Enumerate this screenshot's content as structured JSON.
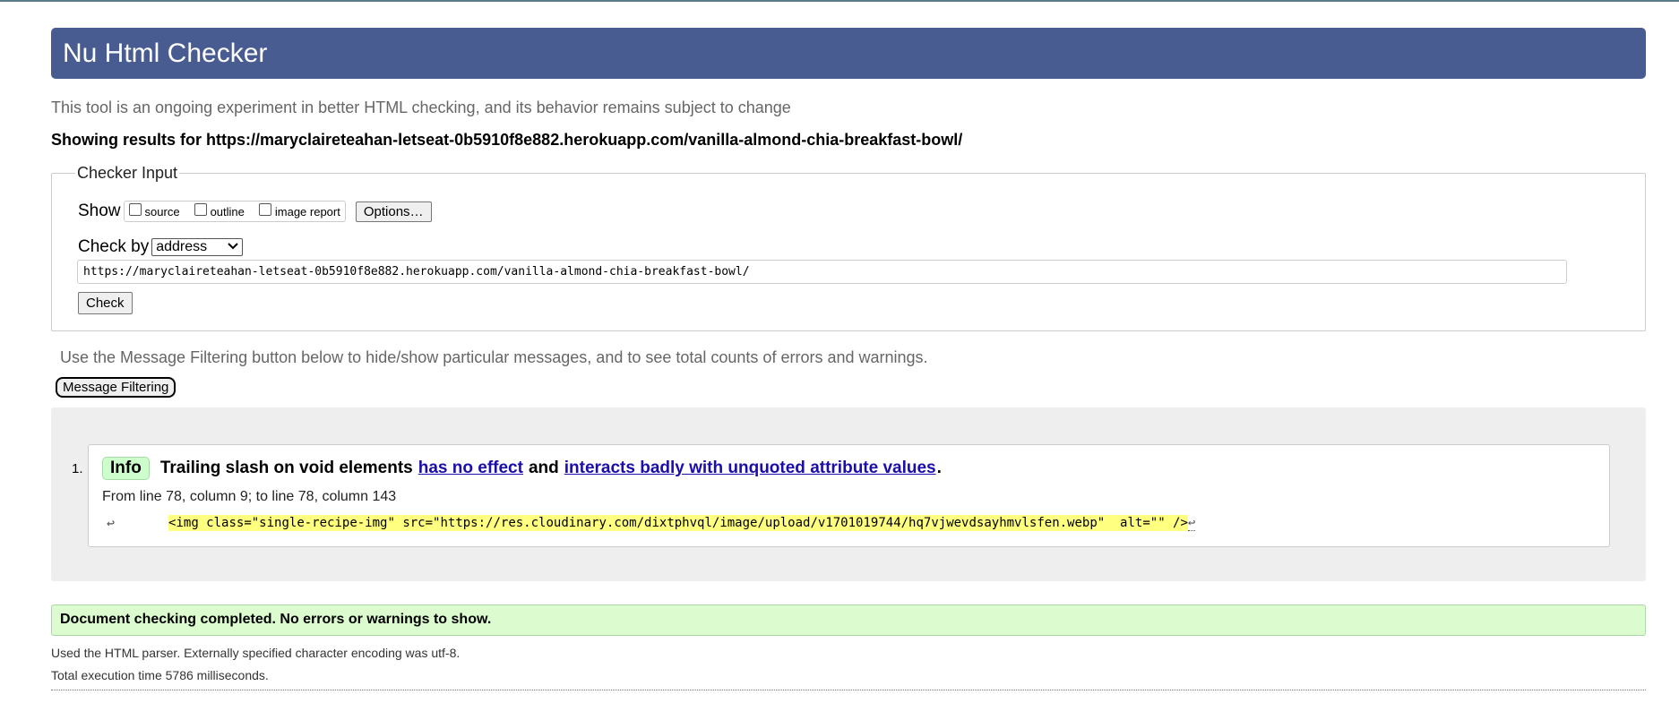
{
  "header": {
    "title": "Nu Html Checker"
  },
  "subtitle": "This tool is an ongoing experiment in better HTML checking, and its behavior remains subject to change",
  "showing_results": "Showing results for https://maryclaireteahan-letseat-0b5910f8e882.herokuapp.com/vanilla-almond-chia-breakfast-bowl/",
  "checker_input": {
    "legend": "Checker Input",
    "show_label": "Show",
    "show_options": [
      "source",
      "outline",
      "image report"
    ],
    "options_button": "Options…",
    "check_by_label": "Check by",
    "check_by_value": "address",
    "url_value": "https://maryclaireteahan-letseat-0b5910f8e882.herokuapp.com/vanilla-almond-chia-breakfast-bowl/",
    "check_button": "Check"
  },
  "filtering": {
    "note": "Use the Message Filtering button below to hide/show particular messages, and to see total counts of errors and warnings.",
    "button": "Message Filtering"
  },
  "messages": [
    {
      "number": "1.",
      "type": "Info",
      "text_before": "Trailing slash on void elements",
      "link1": "has no effect",
      "text_middle": "and",
      "link2": "interacts badly with unquoted attribute values",
      "text_end": ".",
      "location": "From line 78, column 9; to line 78, column 143",
      "return_symbol": "↩",
      "extract": "<img class=\"single-recipe-img\" src=\"https://res.cloudinary.com/dixtphvql/image/upload/v1701019744/hq7vjwevdsayhmvlsfen.webp\"  alt=\"\" />"
    }
  ],
  "status": {
    "completed": "Document checking completed. No errors or warnings to show.",
    "parser": "Used the HTML parser. Externally specified character encoding was utf-8.",
    "execution": "Total execution time 5786 milliseconds."
  },
  "colors": {
    "header_bg": "#485c92",
    "info_badge": "#ccffcc",
    "success_bg": "#dcfcd0",
    "code_highlight": "#ffff80",
    "results_bg": "#eeeeee"
  }
}
